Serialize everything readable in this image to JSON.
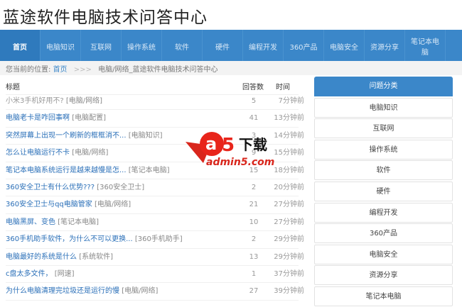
{
  "site_title": "蓝途软件电脑技术问答中心",
  "nav": [
    "首页",
    "电脑知识",
    "互联网",
    "操作系统",
    "软件",
    "硬件",
    "编程开发",
    "360产品",
    "电脑安全",
    "资源分享",
    "笔记本电脑"
  ],
  "breadcrumb": {
    "prefix": "您当前的位置:",
    "home": "首页",
    "sep": ">>>",
    "current": "电脑/网络_蓝途软件电脑技术问答中心"
  },
  "table": {
    "headers": [
      "标题",
      "回答数",
      "时间"
    ],
    "rows": [
      {
        "q": "小米3手机好用不?",
        "cat": "[电脑/网络]",
        "n": "5",
        "t": "7分钟前"
      },
      {
        "q": "电脑老卡是咋回事啊",
        "cat": "[电脑配置]",
        "n": "41",
        "t": "13分钟前"
      },
      {
        "q": "突然屏幕上出现一个刷新的框框消不...",
        "cat": "[电脑知识]",
        "n": "3",
        "t": "14分钟前"
      },
      {
        "q": "怎么让电脑运行不卡",
        "cat": "[电脑/网络]",
        "n": "9",
        "t": "15分钟前"
      },
      {
        "q": "笔记本电脑系统运行是越来越慢是怎...",
        "cat": "[笔记本电脑]",
        "n": "15",
        "t": "18分钟前"
      },
      {
        "q": "360安全卫士有什么优势???",
        "cat": "[360安全卫士]",
        "n": "2",
        "t": "20分钟前"
      },
      {
        "q": "360安全卫士与qq电脑管家",
        "cat": "[电脑/网络]",
        "n": "21",
        "t": "27分钟前"
      },
      {
        "q": "电脑黑屏、变色",
        "cat": "[笔记本电脑]",
        "n": "10",
        "t": "27分钟前"
      },
      {
        "q": "360手机助手软件，为什么不可以更换...",
        "cat": "[360手机助手]",
        "n": "2",
        "t": "29分钟前"
      },
      {
        "q": "电脑最好的系统是什么",
        "cat": "[系统软件]",
        "n": "13",
        "t": "29分钟前"
      },
      {
        "q": "c盘太多文件，",
        "cat": "[网速]",
        "n": "1",
        "t": "37分钟前"
      },
      {
        "q": "为什么电脑清理完垃圾还是运行的慢",
        "cat": "[电脑/网络]",
        "n": "27",
        "t": "39分钟前"
      }
    ]
  },
  "sidebar": {
    "title": "问题分类",
    "items": [
      "电脑知识",
      "互联网",
      "操作系统",
      "软件",
      "硬件",
      "编程开发",
      "360产品",
      "电脑安全",
      "资源分享",
      "笔记本电脑"
    ]
  },
  "watermark": {
    "logo": "a5下载",
    "url": "admin5.com"
  }
}
